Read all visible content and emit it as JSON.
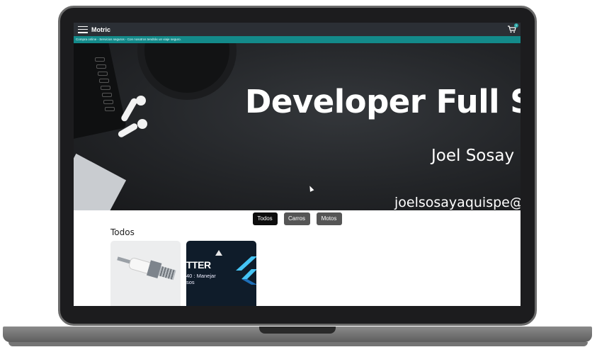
{
  "app": {
    "brand": "Motric",
    "cart_count": "1",
    "announcement": "Compra online - Servicios seguros - Con nosotros tendrás un viaje seguro."
  },
  "hero": {
    "title": "Developer Full S",
    "subtitle": "Joel Sosay",
    "email": "joelsosayaquispe@"
  },
  "filters": [
    {
      "label": "Todos",
      "active": true
    },
    {
      "label": "Carros",
      "active": false
    },
    {
      "label": "Motos",
      "active": false
    }
  ],
  "section": {
    "title": "Todos"
  },
  "cards": [
    {
      "kind": "spark-plug-image"
    },
    {
      "kind": "flutter-course-image",
      "title_fragment": "TTER",
      "subtitle_fragment": "40 : Manejar\nsos"
    }
  ],
  "colors": {
    "topbar": "#2b2f35",
    "announcement_bar": "#138a8a",
    "active_filter": "#0d0d0d",
    "inactive_filter": "#555555",
    "hero_indicator": "#2f6fd6",
    "flutter_blue": "#45c4f5"
  },
  "icons": [
    "menu-icon",
    "cart-icon",
    "mouse-cursor-icon",
    "flutter-logo-icon",
    "play-icon"
  ]
}
